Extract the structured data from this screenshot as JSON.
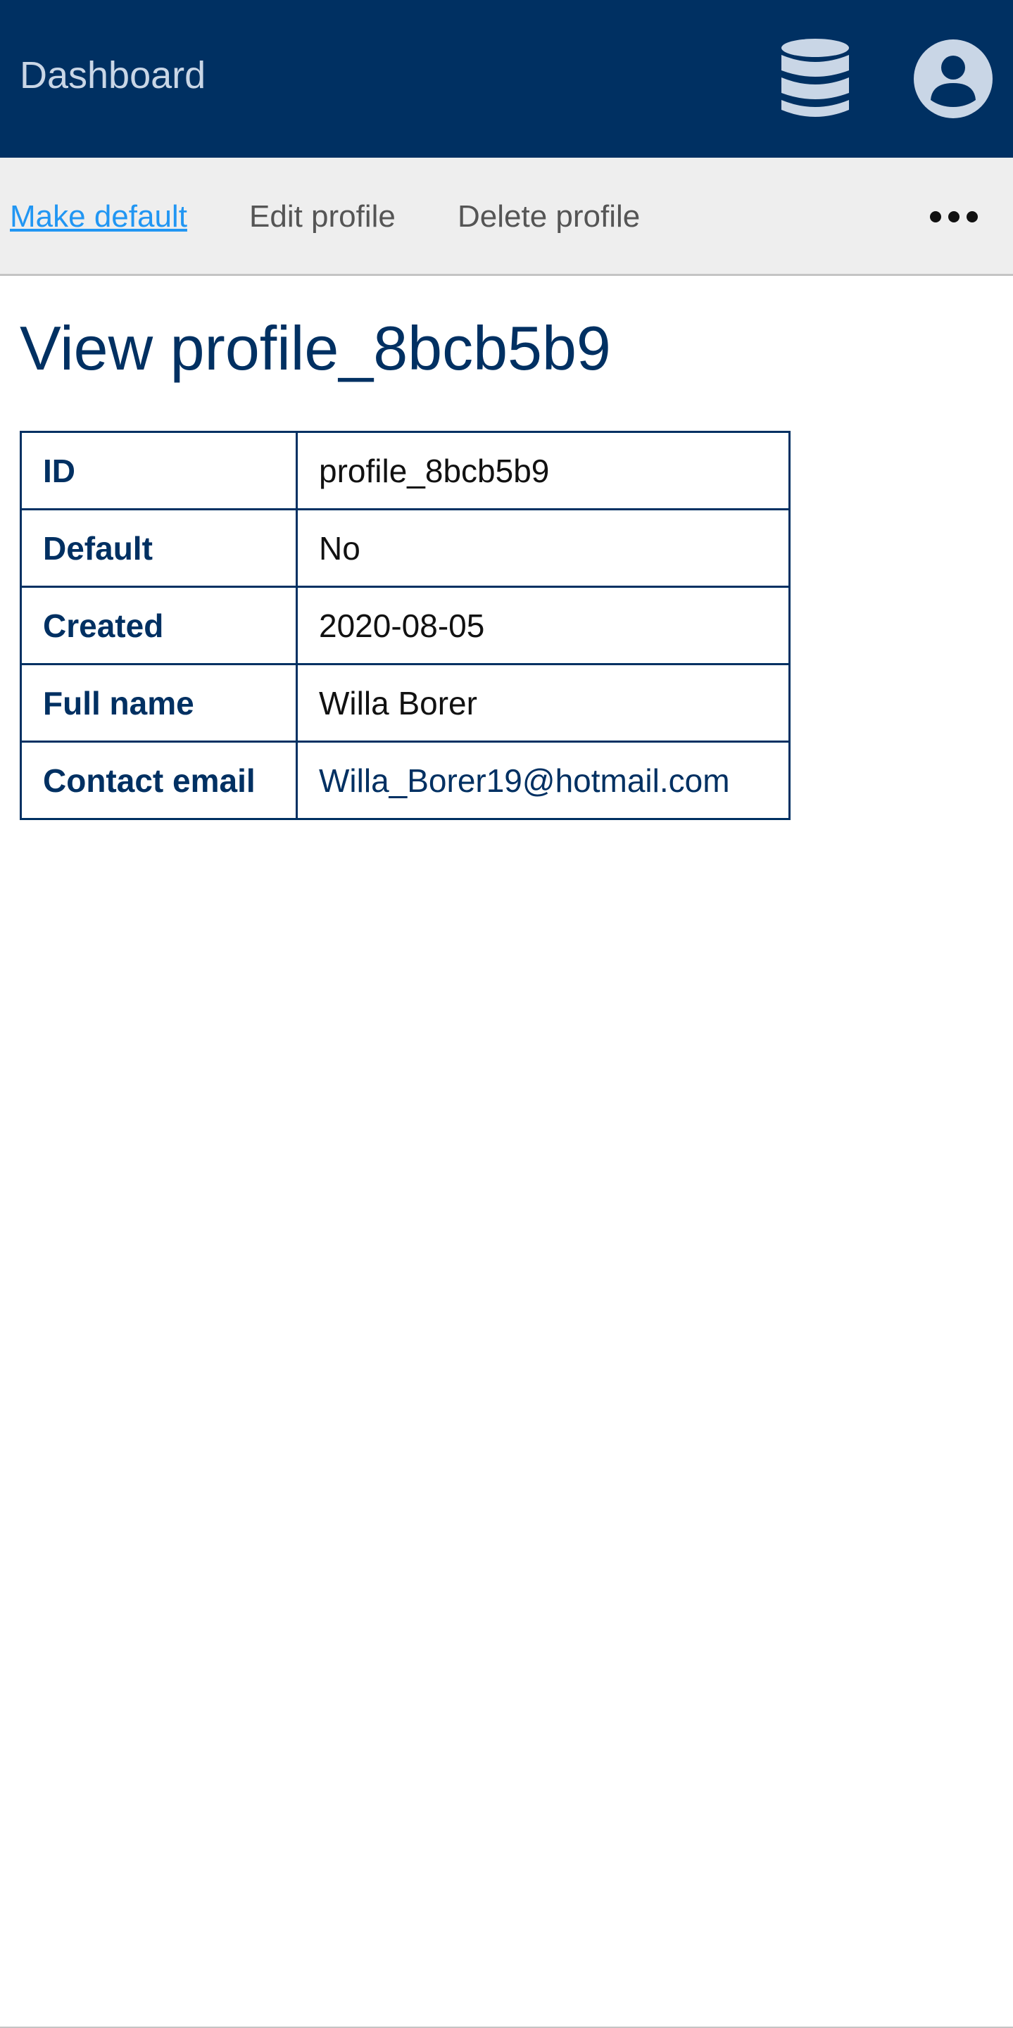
{
  "header": {
    "title": "Dashboard",
    "icons": [
      "database-icon",
      "user-account-icon"
    ],
    "background_color": "#003062"
  },
  "toolbar": {
    "make_default_label": "Make default",
    "edit_profile_label": "Edit profile",
    "delete_profile_label": "Delete profile",
    "more_icon": "more-horizontal-icon",
    "link_color": "#2196f3"
  },
  "main": {
    "page_title": "View profile_8bcb5b9",
    "details": [
      {
        "label": "ID",
        "value": "profile_8bcb5b9"
      },
      {
        "label": "Default",
        "value": "No"
      },
      {
        "label": "Created",
        "value": "2020-08-05"
      },
      {
        "label": "Full name",
        "value": "Willa Borer"
      },
      {
        "label": "Contact email",
        "value": "Willa_Borer19@hotmail.com"
      }
    ]
  }
}
